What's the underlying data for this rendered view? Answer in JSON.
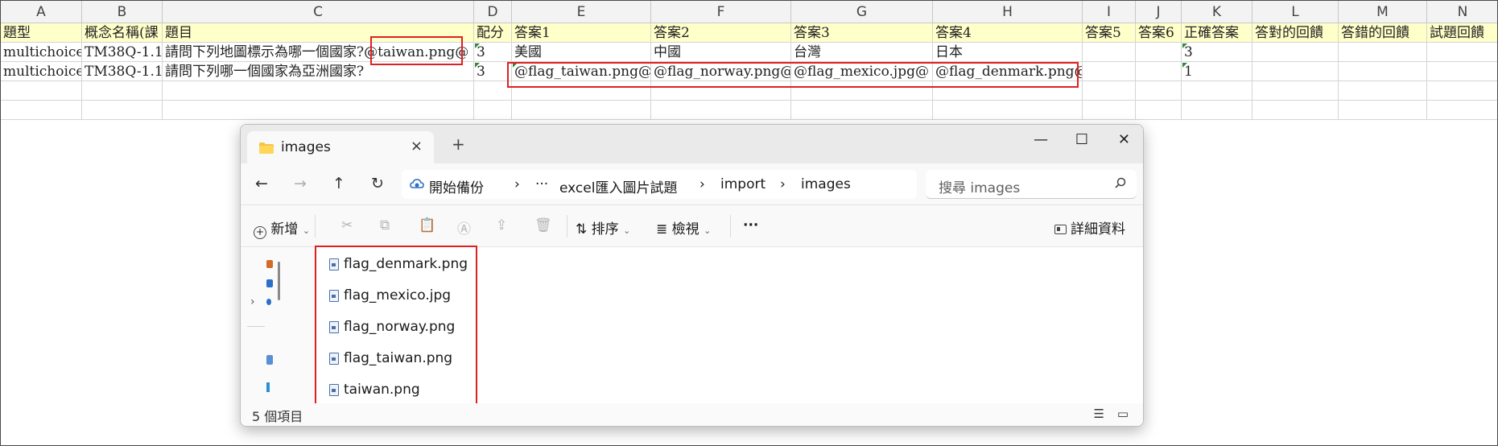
{
  "sheet": {
    "columns": [
      "A",
      "B",
      "C",
      "D",
      "E",
      "F",
      "G",
      "H",
      "I",
      "J",
      "K",
      "L",
      "M",
      "N"
    ],
    "header_row": [
      "題型",
      "概念名稱(課",
      "題目",
      "配分",
      "答案1",
      "答案2",
      "答案3",
      "答案4",
      "答案5",
      "答案6",
      "正確答案",
      "答對的回饋",
      "答錯的回饋",
      "試題回饋"
    ],
    "rows": [
      [
        "multichoice",
        "TM38Q-1.1",
        "請問下列地圖標示為哪一個國家?@taiwan.png@",
        "3",
        "美國",
        "中國",
        "台灣",
        "日本",
        "",
        "",
        "3",
        "",
        "",
        ""
      ],
      [
        "multichoice",
        "TM38Q-1.1",
        "請問下列哪一個國家為亞洲國家?",
        "3",
        "@flag_taiwan.png@",
        "@flag_norway.png@",
        "@flag_mexico.jpg@",
        "@flag_denmark.png@",
        "",
        "",
        "1",
        "",
        "",
        ""
      ]
    ]
  },
  "explorer": {
    "tab_title": "images",
    "new_tab": "+",
    "close_tab": "×",
    "window": {
      "minimize": "—",
      "maximize": "☐",
      "close": "✕"
    },
    "nav": {
      "back": "←",
      "forward": "→",
      "up": "↑",
      "refresh": "↻"
    },
    "breadcrumb": [
      "開始備份",
      "›",
      "···",
      "excel匯入圖片試題",
      "›",
      "import",
      "›",
      "images"
    ],
    "search_placeholder": "搜尋 images",
    "toolbar": {
      "new": "新增",
      "sort": "排序",
      "view": "檢視",
      "more": "···",
      "details": "詳細資料"
    },
    "files": [
      "flag_denmark.png",
      "flag_mexico.jpg",
      "flag_norway.png",
      "flag_taiwan.png",
      "taiwan.png"
    ],
    "status_count": "5 個項目"
  }
}
